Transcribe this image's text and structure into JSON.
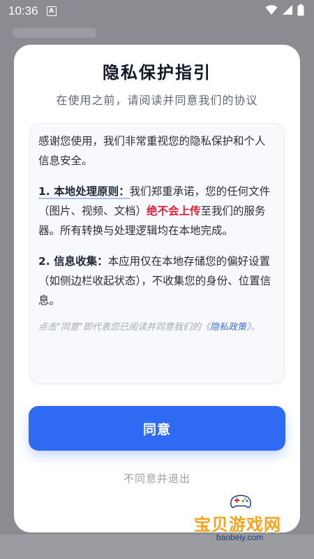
{
  "status_bar": {
    "time": "10:36",
    "notification_icon_letter": "A",
    "icons": [
      "a-notification-icon",
      "wifi-icon",
      "cellular-signal-icon",
      "battery-icon"
    ]
  },
  "dialog": {
    "title": "隐私保护指引",
    "subtitle": "在使用之前，请阅读并同意我们的协议",
    "intro": "感谢您使用，我们非常重视您的隐私保护和个人信息安全。",
    "section1": {
      "title": "1. 本地处理原则：",
      "text_before": "我们郑重承诺，您的任何文件（图片、视频、文档）",
      "highlight": "绝不会上传",
      "text_after": "至我们的服务器。所有转换与处理逻辑均在本地完成。"
    },
    "section2": {
      "title": "2. 信息收集：",
      "text": "本应用仅在本地存储您的偏好设置（如侧边栏收起状态），不收集您的身份、位置信息。"
    },
    "note": {
      "before": "点击\"同意\"即代表您已阅读并同意我们的《",
      "link": "隐私政策",
      "after": "》。"
    },
    "agree_label": "同意",
    "disagree_label": "不同意并退出"
  },
  "watermark": {
    "name": "宝贝游戏网",
    "url": "baobeiy.com"
  },
  "colors": {
    "accent": "#2f6bf2",
    "warning": "#e0203a",
    "link": "#3b6fd8"
  }
}
